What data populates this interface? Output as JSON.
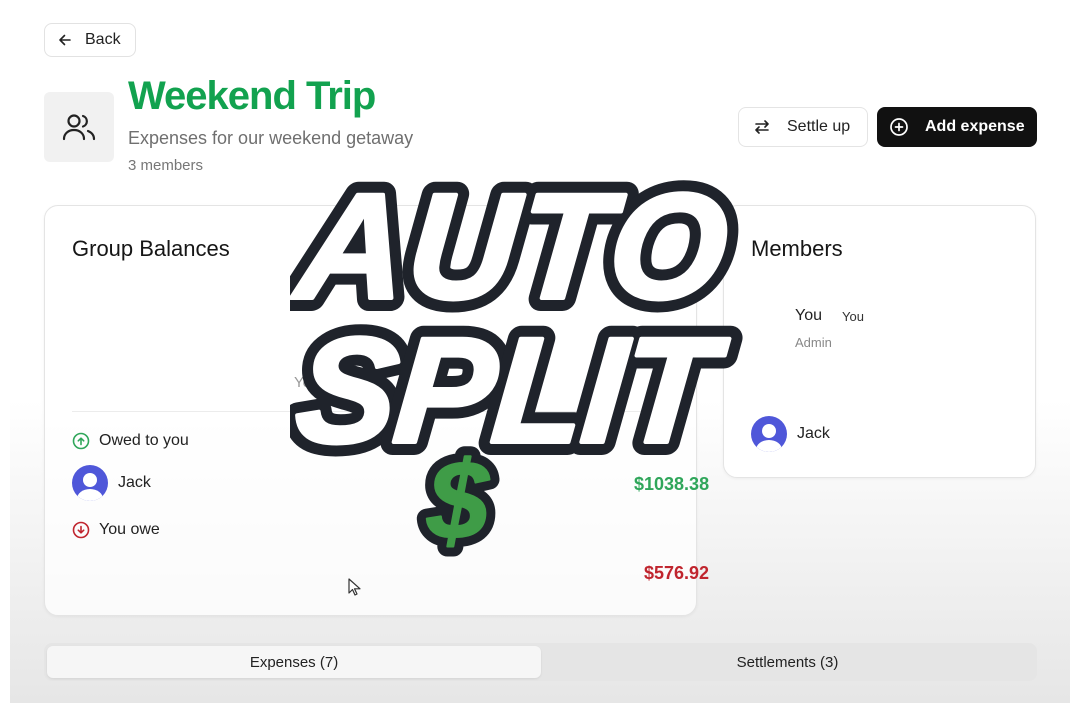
{
  "back_button": {
    "label": "Back"
  },
  "group": {
    "title": "Weekend Trip",
    "subtitle": "Expenses for our weekend getaway",
    "members_count": "3 members"
  },
  "actions": {
    "settle_up": "Settle up",
    "add_expense": "Add expense"
  },
  "balances": {
    "title": "Group Balances",
    "partial_label": "Yo",
    "owed_label": "Owed to you",
    "owed_person": "Jack",
    "owed_amount": "$1038.38",
    "owe_label": "You owe",
    "owe_amount": "$576.92"
  },
  "members_panel": {
    "title": "Members",
    "items": [
      {
        "name": "You",
        "tag": "You",
        "role": "Admin"
      },
      {
        "name": "Jack"
      }
    ]
  },
  "tabs": [
    {
      "label": "Expenses (7)",
      "active": true
    },
    {
      "label": "Settlements (3)",
      "active": false
    }
  ],
  "overlay": {
    "line1": "AUTO",
    "line2": "SPLIT",
    "symbol": "$"
  },
  "colors": {
    "brand_green": "#12a24f",
    "positive": "#2fa65a",
    "negative": "#c0252e",
    "avatar": "#4f57d9",
    "dollar_green": "#3f9c47"
  }
}
